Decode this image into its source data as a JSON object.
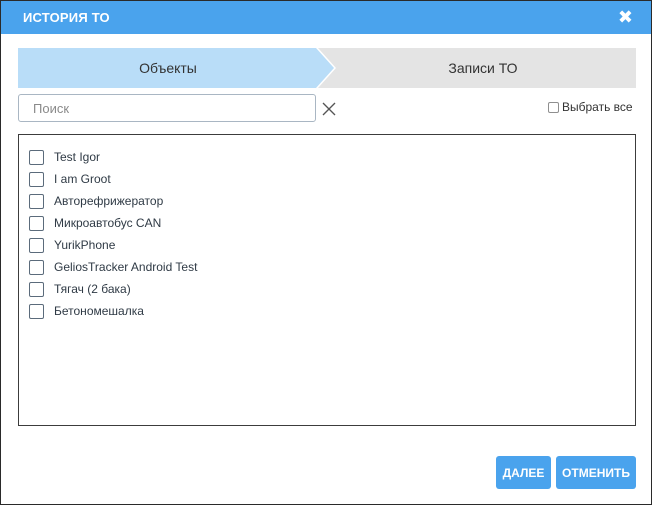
{
  "dialog": {
    "title": "ИСТОРИЯ ТО",
    "close_icon": "close-icon"
  },
  "steps": [
    {
      "label": "Объекты",
      "active": true,
      "active_color": "#b9ddf8"
    },
    {
      "label": "Записи ТО",
      "active": false,
      "inactive_color": "#e4e4e4"
    }
  ],
  "search": {
    "placeholder": "Поиск",
    "value": ""
  },
  "select_all": {
    "label": "Выбрать все",
    "checked": false
  },
  "items": [
    {
      "label": "Test Igor",
      "checked": false
    },
    {
      "label": "I am Groot",
      "checked": false
    },
    {
      "label": "Авторефрижератор",
      "checked": false
    },
    {
      "label": "Микроавтобус CAN",
      "checked": false
    },
    {
      "label": "YurikPhone",
      "checked": false
    },
    {
      "label": "GeliosTracker Android Test",
      "checked": false
    },
    {
      "label": "Тягач (2 бака)",
      "checked": false
    },
    {
      "label": "Бетономешалка",
      "checked": false
    }
  ],
  "buttons": {
    "next_label": "ДАЛЕЕ",
    "cancel_label": "ОТМЕНИТЬ"
  },
  "colors": {
    "accent": "#4aa3ed"
  }
}
